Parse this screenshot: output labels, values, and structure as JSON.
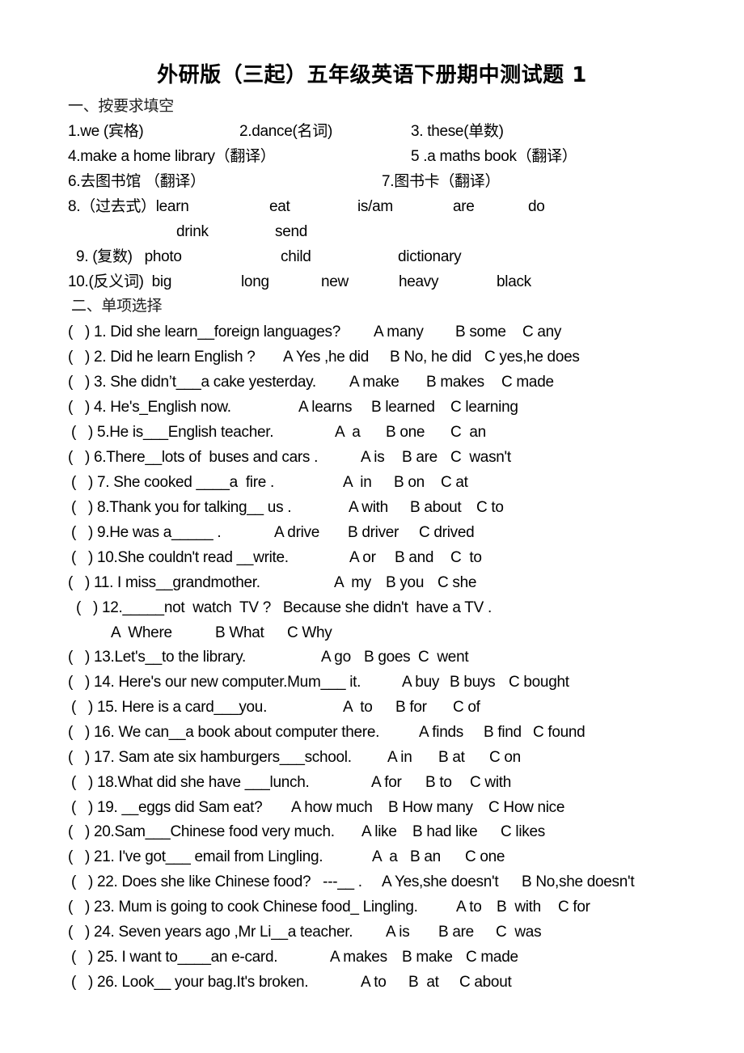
{
  "title": "外研版（三起）五年级英语下册期中测试题 1",
  "section1": {
    "heading": "一、按要求填空",
    "rows": [
      [
        "1.we (宾格)",
        "2.dance(名词)",
        "3. these(单数)"
      ],
      [
        "4.make a home library（翻译）",
        "5 .a maths book（翻译）"
      ],
      [
        "6.去图书馆 （翻译）",
        "7.图书卡（翻译）"
      ],
      [
        "8.（过去式）learn",
        "eat",
        "is/am",
        "are",
        "do"
      ],
      [
        "drink",
        "send"
      ],
      [
        "9. (复数)   photo",
        "child",
        "dictionary"
      ],
      [
        "10.(反义词)  big",
        "long",
        "new",
        "heavy",
        "black"
      ]
    ]
  },
  "section2": {
    "heading": "二、单项选择",
    "questions": [
      {
        "stem": "(   ) 1. Did she learn__foreign languages?",
        "a": "A many",
        "b": "B some",
        "c": "C any"
      },
      {
        "stem": "(   ) 2. Did he learn English ?",
        "a": "A Yes ,he did",
        "b": "B No, he did",
        "c": "C yes,he does"
      },
      {
        "stem": "(   ) 3. She didn’t___a cake yesterday.",
        "a": "A make",
        "b": "B makes",
        "c": "C made"
      },
      {
        "stem": "(   ) 4. He's_English now.",
        "a": "A learns",
        "b": "B learned",
        "c": "C learning"
      },
      {
        "stem": "(   ) 5.He is___English teacher.",
        "a": "A  a",
        "b": "B one",
        "c": "C  an"
      },
      {
        "stem": "(   ) 6.There__lots of  buses and cars .",
        "a": "A is",
        "b": "B are",
        "c": "C  wasn't"
      },
      {
        "stem": "(   ) 7. She cooked ____a  fire .",
        "a": "A  in",
        "b": "B on",
        "c": "C at"
      },
      {
        "stem": "(   ) 8.Thank you for talking__ us .",
        "a": "A with",
        "b": "B about",
        "c": "C to"
      },
      {
        "stem": "(   ) 9.He was a_____ .",
        "a": "A drive",
        "b": "B driver",
        "c": "C drived"
      },
      {
        "stem": "(   ) 10.She couldn't read __write.",
        "a": "A or",
        "b": "B and",
        "c": "C  to"
      },
      {
        "stem": "(   ) 11. I miss__grandmother.",
        "a": "A  my",
        "b": "B you",
        "c": "C she"
      },
      {
        "stem": "(   ) 12._____not  watch  TV ?   Because she didn't  have a TV .",
        "a": "A  Where",
        "b": "B What",
        "c": "C Why"
      },
      {
        "stem": "(   ) 13.Let's__to the library.",
        "a": "A go",
        "b": "B goes",
        "c": "C  went"
      },
      {
        "stem": "(   ) 14. Here's our new computer.Mum___ it.",
        "a": "A buy",
        "b": "B buys",
        "c": "C bought"
      },
      {
        "stem": "(   ) 15. Here is a card___you.",
        "a": "A  to",
        "b": "B for",
        "c": "C of"
      },
      {
        "stem": "(   ) 16. We can__a book about computer there.",
        "a": "A finds",
        "b": "B find",
        "c": "C found"
      },
      {
        "stem": "(   ) 17. Sam ate six hamburgers___school.",
        "a": "A in",
        "b": "B at",
        "c": "C on"
      },
      {
        "stem": "(   ) 18.What did she have ___lunch.",
        "a": "A for",
        "b": "B to",
        "c": "C with"
      },
      {
        "stem": "(   ) 19. __eggs did Sam eat?",
        "a": "A how much",
        "b": "B How many",
        "c": "C How nice"
      },
      {
        "stem": "(   ) 20.Sam___Chinese food very much.",
        "a": "A like",
        "b": "B had like",
        "c": "C likes"
      },
      {
        "stem": "(   ) 21. I've got___ email from Lingling.",
        "a": "A  a",
        "b": "B an",
        "c": "C one"
      },
      {
        "stem": "(   ) 22. Does she like Chinese food?   ---__ .",
        "a": "A Yes,she doesn't",
        "b": "B No,she doesn't",
        "c": ""
      },
      {
        "stem": "(   ) 23. Mum is going to cook Chinese food_ Lingling.",
        "a": "A to",
        "b": "B  with",
        "c": "C for"
      },
      {
        "stem": "(   ) 24. Seven years ago ,Mr Li__a teacher.",
        "a": "A is",
        "b": "B are",
        "c": "C  was"
      },
      {
        "stem": "(   ) 25. I want to____an e-card.",
        "a": "A makes",
        "b": "B make",
        "c": "C made"
      },
      {
        "stem": "(   ) 26. Look__ your bag.It's broken.",
        "a": "A to",
        "b": "B  at",
        "c": "C about"
      }
    ]
  }
}
